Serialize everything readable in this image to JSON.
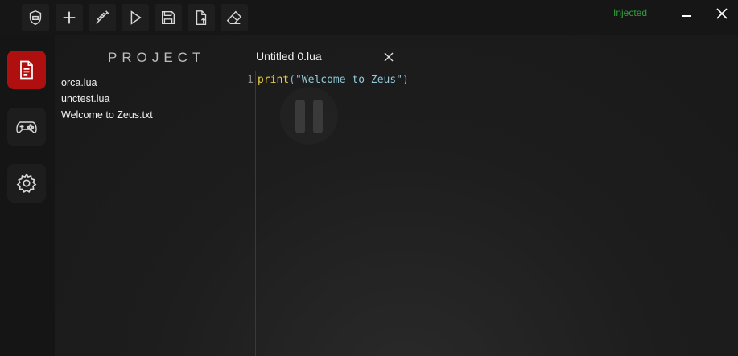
{
  "toolbar": {
    "buttons": [
      {
        "icon": "shield-icon"
      },
      {
        "icon": "plus-icon"
      },
      {
        "icon": "syringe-icon"
      },
      {
        "icon": "play-icon"
      },
      {
        "icon": "save-icon"
      },
      {
        "icon": "open-file-icon"
      },
      {
        "icon": "eraser-icon"
      }
    ],
    "status": "Injected"
  },
  "colors": {
    "accent": "#b00f0f",
    "status": "#2fa03a",
    "keyword": "#e6c94a",
    "string": "#8fc7d8"
  },
  "rail": {
    "items": [
      {
        "icon": "document-icon",
        "active": true
      },
      {
        "icon": "gamepad-icon",
        "active": false
      },
      {
        "icon": "gear-icon",
        "active": false
      }
    ]
  },
  "project": {
    "title": "PROJECT",
    "files": [
      "orca.lua",
      "unctest.lua",
      "Welcome to Zeus.txt"
    ]
  },
  "editor": {
    "tab_title": "Untitled 0.lua",
    "line_number": "1",
    "code": {
      "keyword": "print",
      "open_paren": "(",
      "string": "\"Welcome to Zeus\"",
      "close_paren": ")"
    }
  }
}
